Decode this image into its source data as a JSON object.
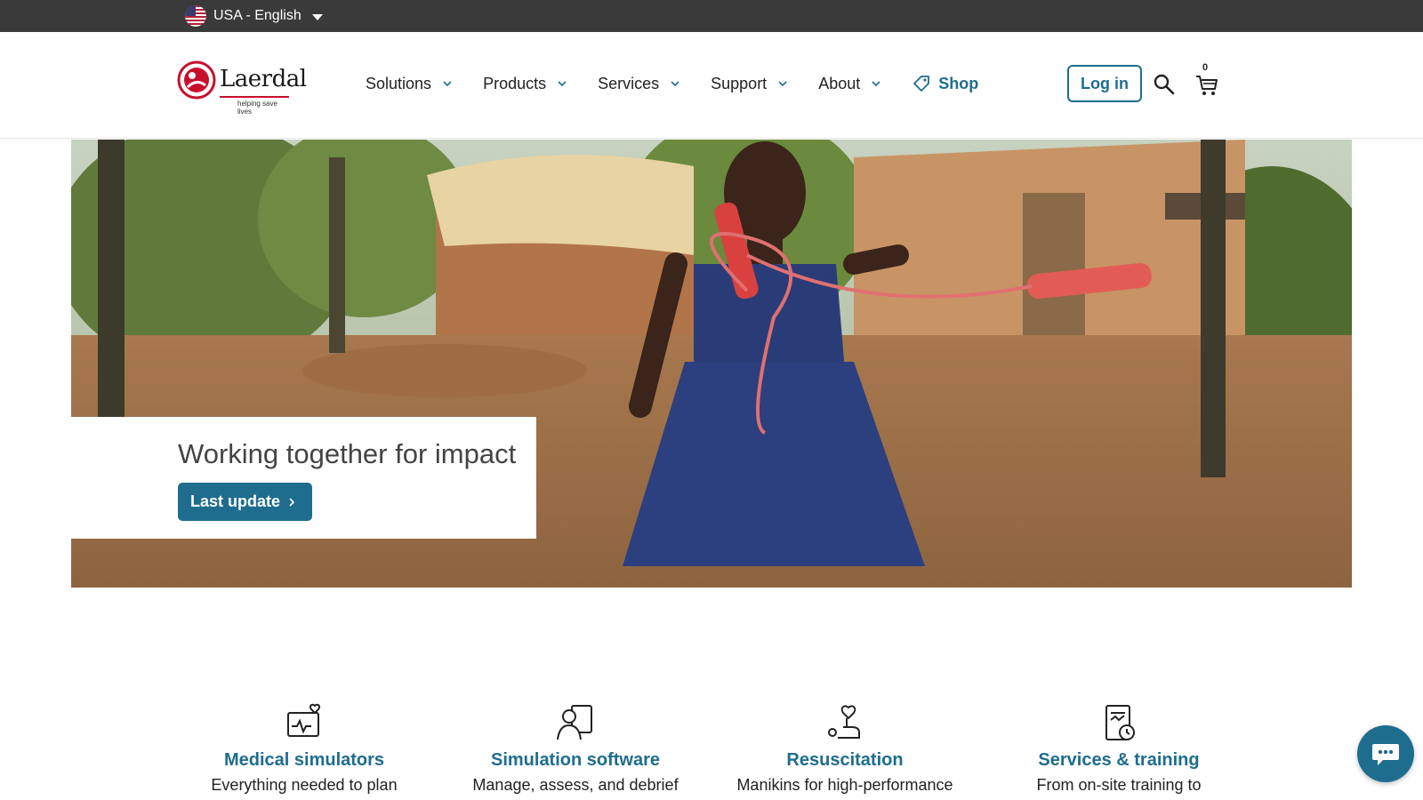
{
  "topbar": {
    "locale_label": "USA - English",
    "flag_icon": "us-flag-icon"
  },
  "header": {
    "logo": {
      "name": "Laerdal",
      "tagline": "helping save lives"
    },
    "nav": [
      {
        "label": "Solutions"
      },
      {
        "label": "Products"
      },
      {
        "label": "Services"
      },
      {
        "label": "Support"
      },
      {
        "label": "About"
      }
    ],
    "shop_label": "Shop",
    "login_label": "Log in",
    "cart_count": "0"
  },
  "hero": {
    "title": "Working together for impact",
    "button_label": "Last update"
  },
  "categories": [
    {
      "icon": "monitor-heart-icon",
      "title": "Medical simulators",
      "desc": "Everything needed to plan"
    },
    {
      "icon": "user-screen-icon",
      "title": "Simulation software",
      "desc": "Manage, assess, and debrief"
    },
    {
      "icon": "hand-heart-icon",
      "title": "Resuscitation",
      "desc": "Manikins for high-performance"
    },
    {
      "icon": "clipboard-clock-icon",
      "title": "Services & training",
      "desc": "From on-site training to"
    }
  ],
  "colors": {
    "brand_blue": "#1e6d8f",
    "topbar": "#3a3a3a",
    "logo_red": "#c8102e"
  }
}
